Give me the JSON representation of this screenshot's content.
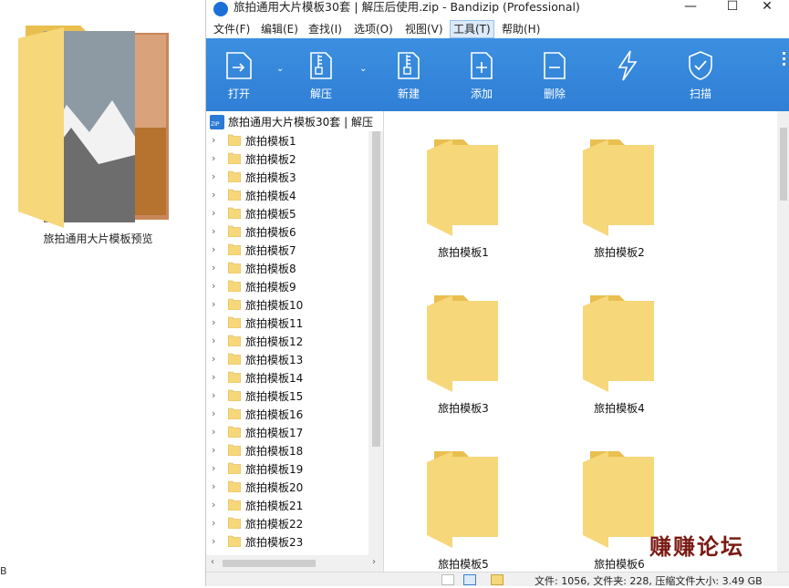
{
  "desktop": {
    "folder_label": "旅拍通用大片模板预览",
    "edge_text": "B"
  },
  "window": {
    "title": "旅拍通用大片模板30套 | 解压后使用.zip - Bandizip (Professional)",
    "controls": {
      "minimize": "—",
      "maximize": "☐",
      "close": "✕"
    }
  },
  "menu": [
    {
      "label": "文件(F)"
    },
    {
      "label": "编辑(E)"
    },
    {
      "label": "查找(I)"
    },
    {
      "label": "选项(O)"
    },
    {
      "label": "视图(V)"
    },
    {
      "label": "工具(T)"
    },
    {
      "label": "帮助(H)"
    }
  ],
  "toolbar": {
    "open": "打开",
    "extract": "解压",
    "new": "新建",
    "add": "添加",
    "delete": "删除",
    "scan": "扫描"
  },
  "tree": {
    "root": "旅拍通用大片模板30套 | 解压",
    "items": [
      "旅拍模板1",
      "旅拍模板2",
      "旅拍模板3",
      "旅拍模板4",
      "旅拍模板5",
      "旅拍模板6",
      "旅拍模板7",
      "旅拍模板8",
      "旅拍模板9",
      "旅拍模板10",
      "旅拍模板11",
      "旅拍模板12",
      "旅拍模板13",
      "旅拍模板14",
      "旅拍模板15",
      "旅拍模板16",
      "旅拍模板17",
      "旅拍模板18",
      "旅拍模板19",
      "旅拍模板20",
      "旅拍模板21",
      "旅拍模板22",
      "旅拍模板23"
    ]
  },
  "files": [
    "旅拍模板1",
    "旅拍模板2",
    "旅拍模板3",
    "旅拍模板4",
    "旅拍模板5",
    "旅拍模板6"
  ],
  "watermark": "赚赚论坛",
  "status": {
    "text": "文件: 1056, 文件夹: 228, 压缩文件大小: 3.49 GB"
  },
  "colors": {
    "toolbar": "#2f7fd6",
    "folder": "#f6d77a",
    "folder_dark": "#e9bf4f",
    "watermark": "#7a1a14"
  }
}
